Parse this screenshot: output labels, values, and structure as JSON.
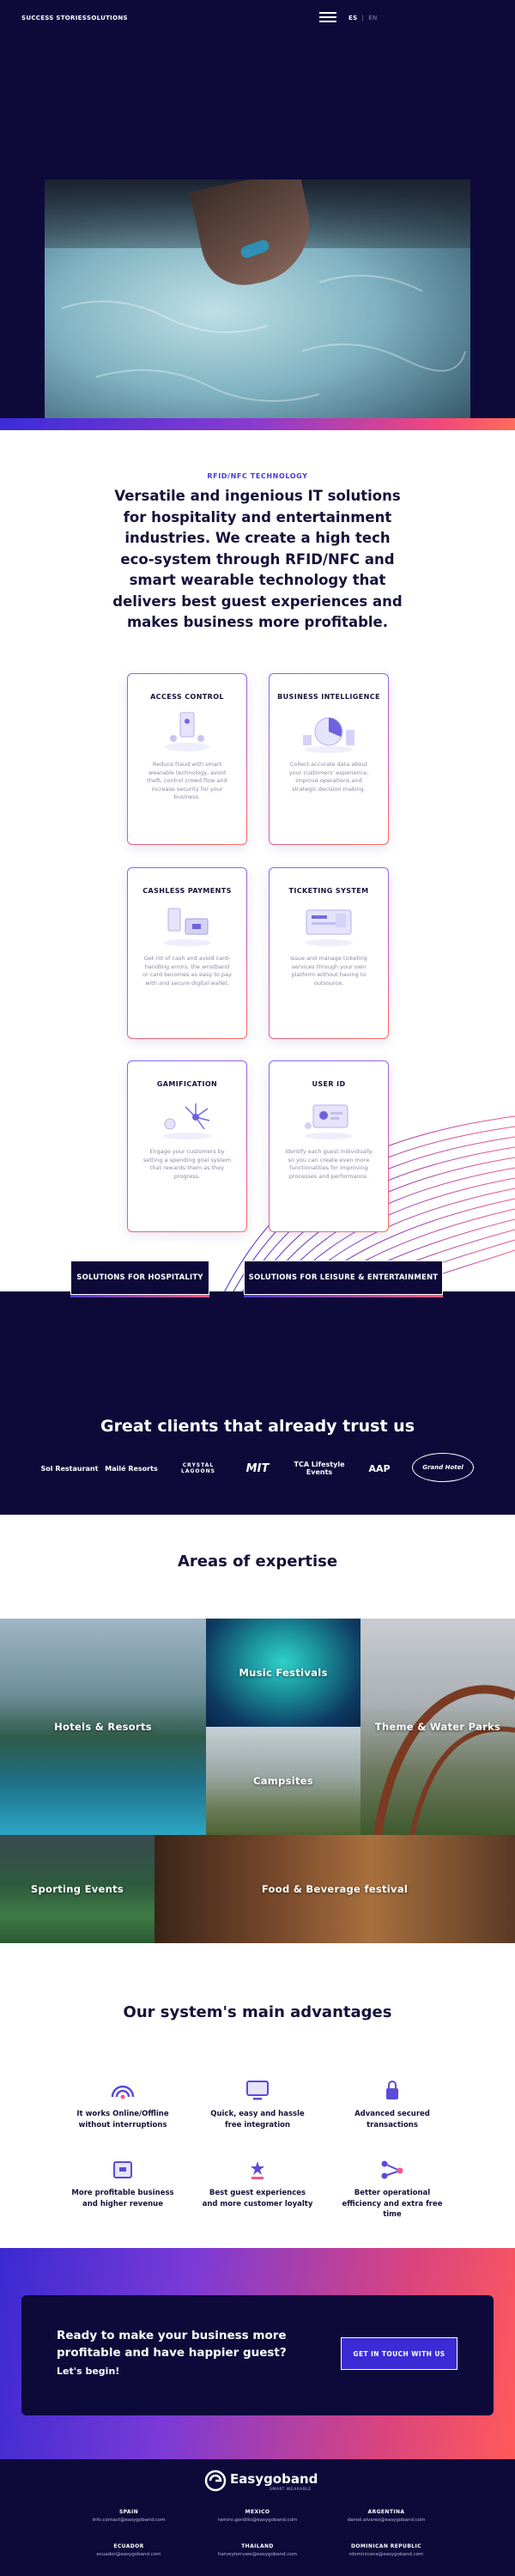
{
  "nav": {
    "links": [
      "SUCCESS STORIES",
      "SOLUTIONS"
    ],
    "lang_active": "ES",
    "lang_inactive": "EN",
    "menu_icon": "hamburger-icon"
  },
  "hero": {
    "image": "photo of a hand wearing a blue wristband in pool water"
  },
  "intro": {
    "eyebrow": "RFID/NFC TECHNOLOGY",
    "headline": "Versatile and ingenious IT solutions for hospitality and entertainment industries. We create a high tech eco-system through RFID/NFC and smart wearable technology that delivers best guest experiences and makes business more profitable."
  },
  "features": [
    {
      "title": "ACCESS CONTROL",
      "text": "Reduce fraud with smart wearable technology, avoid theft, control crowd flow and increase security for your business.",
      "icon": "access-control-icon"
    },
    {
      "title": "BUSINESS INTELLIGENCE",
      "text": "Collect accurate data about your customers' experience, improve operations and strategic decision making.",
      "icon": "business-intelligence-icon"
    },
    {
      "title": "CASHLESS PAYMENTS",
      "text": "Get rid of cash and avoid card-handling errors, the wristband or card becomes as easy to pay with and secure digital wallet.",
      "icon": "cashless-payments-icon"
    },
    {
      "title": "TICKETING SYSTEM",
      "text": "Issue and manage ticketing services through your own platform without having to outsource.",
      "icon": "ticketing-system-icon"
    },
    {
      "title": "GAMIFICATION",
      "text": "Engage your customers by setting a spending goal system that rewards them as they progress.",
      "icon": "gamification-icon"
    },
    {
      "title": "USER ID",
      "text": "Identify each guest individually so you can create even more functionalities for improving processes and performance.",
      "icon": "user-id-icon"
    }
  ],
  "solutions": {
    "hospitality": "SOLUTIONS FOR HOSPITALITY",
    "leisure": "SOLUTIONS FOR LEISURE & ENTERTAINMENT"
  },
  "clients": {
    "title": "Great clients that already trust us",
    "logos": [
      "Sol Restaurant",
      "Mailé Resorts",
      "CRYSTAL LAGOONS",
      "MIT",
      "TCA Lifestyle Events",
      "AAP",
      "Grand Hotel"
    ]
  },
  "expertise": {
    "title": "Areas of expertise",
    "tiles": [
      "Hotels & Resorts",
      "Music Festivals",
      "Theme & Water Parks",
      "Campsites",
      "Sporting Events",
      "Food & Beverage festival"
    ]
  },
  "advantages": {
    "title": "Our system's main advantages",
    "items": [
      {
        "text": "It works Online/Offline without interruptions",
        "icon": "wifi-icon"
      },
      {
        "text": "Quick, easy and hassle free integration",
        "icon": "monitor-icon"
      },
      {
        "text": "Advanced secured transactions",
        "icon": "lock-icon"
      },
      {
        "text": "More profitable business and higher revenue",
        "icon": "wallet-icon"
      },
      {
        "text": "Best guest experiences and more customer loyalty",
        "icon": "loyalty-icon"
      },
      {
        "text": "Better operational efficiency and extra free time",
        "icon": "efficiency-icon"
      }
    ]
  },
  "cta": {
    "headline": "Ready to make your business more profitable and have happier guest?",
    "sub": "Let's begin!",
    "button": "GET IN TOUCH WITH US"
  },
  "footer": {
    "brand": "Easygoband",
    "tagline": "SMART WEARABLE",
    "offices": [
      {
        "country": "SPAIN",
        "email": "info.contact@easygoband.com"
      },
      {
        "country": "MEXICO",
        "email": "ramiro.gordillo@easygoband.com"
      },
      {
        "country": "ARGENTINA",
        "email": "daniel.alvarez@easygoband.com"
      },
      {
        "country": "ECUADOR",
        "email": "ecuador@easygoband.com"
      },
      {
        "country": "THAILAND",
        "email": "harveylerruwe@easygoband.com"
      },
      {
        "country": "DOMINICAN REPUBLIC",
        "email": "rdominicana@easygoband.com"
      }
    ]
  },
  "colors": {
    "navy": "#0d0a3a",
    "accent": "#4a38d6",
    "gradient_start": "#3c2cd9",
    "gradient_end": "#ff6b5a"
  }
}
